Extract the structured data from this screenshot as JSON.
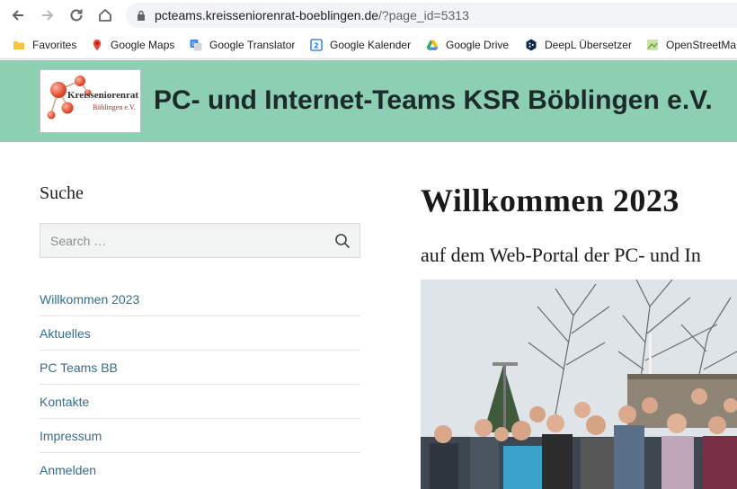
{
  "browser": {
    "url_host": "pcteams.kreisseniorenrat-boeblingen.de",
    "url_path": "/?page_id=5313",
    "bookmarks": [
      {
        "label": "Favorites",
        "icon": "folder-icon"
      },
      {
        "label": "Google Maps",
        "icon": "maps-pin-icon"
      },
      {
        "label": "Google Translator",
        "icon": "translate-icon"
      },
      {
        "label": "Google Kalender",
        "icon": "calendar-icon"
      },
      {
        "label": "Google Drive",
        "icon": "drive-icon"
      },
      {
        "label": "DeepL Übersetzer",
        "icon": "deepl-icon"
      },
      {
        "label": "OpenStreetMa",
        "icon": "map-icon"
      }
    ]
  },
  "header": {
    "logo_line1": "Kreisseniorenrat",
    "logo_line2": "Böblingen e.V.",
    "site_title": "PC- und Internet-Teams KSR Böblingen e.V.",
    "background_color": "#8ccfb2"
  },
  "sidebar": {
    "search_title": "Suche",
    "search_placeholder": "Search …",
    "menu": [
      "Willkommen 2023",
      "Aktuelles",
      "PC Teams BB",
      "Kontakte",
      "Impressum",
      "Anmelden"
    ],
    "link_color": "#2f6f8f"
  },
  "main": {
    "page_title": "Willkommen 2023",
    "subtitle": "auf dem Web-Portal der PC- und In"
  }
}
